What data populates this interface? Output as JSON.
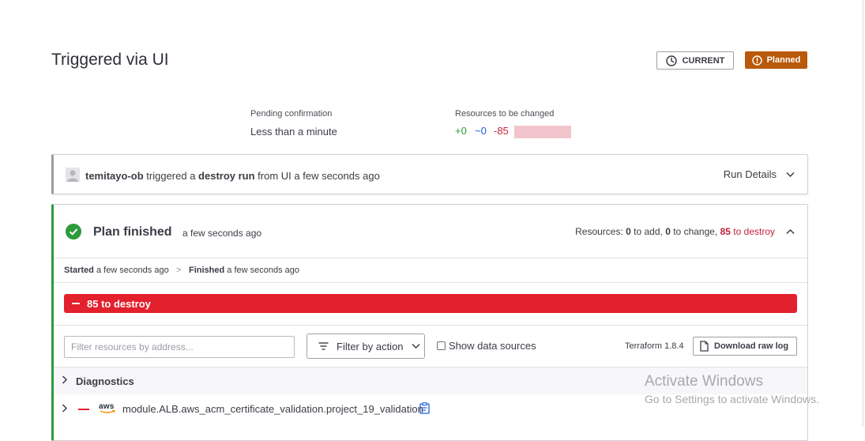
{
  "page": {
    "title": "Triggered via UI",
    "current_button": {
      "label": "CURRENT",
      "icon": "clock-icon"
    },
    "status_badge": {
      "label": "Planned",
      "icon": "alert-circle-icon",
      "color": "#b9590a"
    }
  },
  "summary": {
    "pending_label": "Pending confirmation",
    "pending_value": "Less than a minute",
    "resources_label": "Resources to be changed",
    "add": "+0",
    "change": "~0",
    "destroy": "-85",
    "colors": {
      "add": "#2d9a3c",
      "change": "#1f5fd6",
      "destroy": "#c0233b"
    }
  },
  "trigger": {
    "user": "temitayo-ob",
    "text1": " triggered a ",
    "run_type": "destroy run",
    "text2": " from UI a few seconds ago",
    "run_details_label": "Run Details"
  },
  "plan": {
    "title": "Plan finished",
    "time": "a few seconds ago",
    "resources_prefix": "Resources: ",
    "add_count": "0",
    "add_label": " to add, ",
    "change_count": "0",
    "change_label": " to change, ",
    "destroy_count": "85",
    "destroy_label": " to destroy",
    "started_label": "Started",
    "started_time": " a few seconds ago",
    "separator": ">",
    "finished_label": "Finished",
    "finished_time": " a few seconds ago",
    "destroy_bar": "85 to destroy",
    "destroy_color": "#e3202d"
  },
  "filters": {
    "search_placeholder": "Filter resources by address...",
    "filter_label": "Filter by action",
    "show_data_sources": "Show data sources",
    "terraform_version": "Terraform 1.8.4",
    "download_label": "Download raw log"
  },
  "diagnostics": {
    "label": "Diagnostics"
  },
  "resources": [
    {
      "provider": "aws",
      "address": "module.ALB.aws_acm_certificate_validation.project_19_validation"
    }
  ],
  "watermark": {
    "title": "Activate Windows",
    "subtitle": "Go to Settings to activate Windows."
  }
}
